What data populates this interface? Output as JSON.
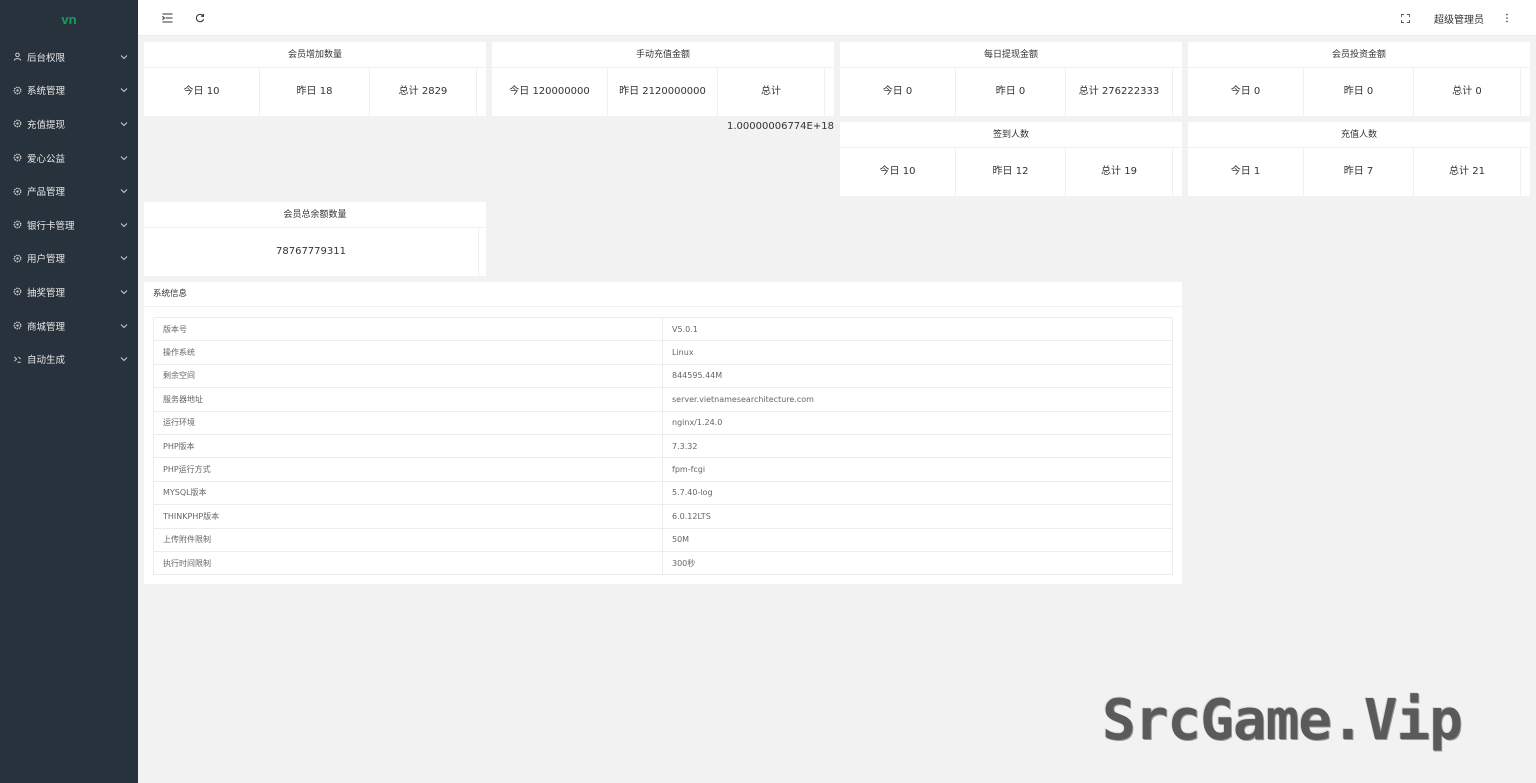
{
  "sidebar": {
    "logo": "vn",
    "items": [
      {
        "label": "后台权限",
        "icon": "user-icon"
      },
      {
        "label": "系统管理",
        "icon": "gear-icon"
      },
      {
        "label": "充值提现",
        "icon": "gear-icon"
      },
      {
        "label": "爱心公益",
        "icon": "gear-icon"
      },
      {
        "label": "产品管理",
        "icon": "gear-icon"
      },
      {
        "label": "银行卡管理",
        "icon": "gear-icon"
      },
      {
        "label": "用户管理",
        "icon": "gear-icon"
      },
      {
        "label": "抽奖管理",
        "icon": "gear-icon"
      },
      {
        "label": "商城管理",
        "icon": "gear-icon"
      },
      {
        "label": "自动生成",
        "icon": "code-icon"
      }
    ]
  },
  "header": {
    "admin_name": "超级管理员"
  },
  "cards": {
    "member_increase": {
      "title": "会员增加数量",
      "today": "今日 10",
      "yesterday": "昨日 18",
      "total": "总计 2829"
    },
    "manual_recharge": {
      "title": "手动充值金额",
      "today": "今日 120000000",
      "yesterday": "昨日 2120000000",
      "total": "总计",
      "total_value": "1.00000006774E+18"
    },
    "daily_withdraw": {
      "title": "每日提现金额",
      "today": "今日 0",
      "yesterday": "昨日 0",
      "total": "总计 276222333"
    },
    "member_invest": {
      "title": "会员投资金额",
      "today": "今日 0",
      "yesterday": "昨日 0",
      "total": "总计 0"
    },
    "checkin_count": {
      "title": "签到人数",
      "today": "今日 10",
      "yesterday": "昨日 12",
      "total": "总计 19"
    },
    "recharge_count": {
      "title": "充值人数",
      "today": "今日 1",
      "yesterday": "昨日 7",
      "total": "总计 21"
    },
    "member_balance": {
      "title": "会员总余额数量",
      "value": "78767779311"
    }
  },
  "system_info": {
    "title": "系统信息",
    "rows": [
      {
        "key": "版本号",
        "value": "V5.0.1"
      },
      {
        "key": "操作系统",
        "value": "Linux"
      },
      {
        "key": "剩余空间",
        "value": "844595.44M"
      },
      {
        "key": "服务器地址",
        "value": "server.vietnamesearchitecture.com"
      },
      {
        "key": "运行环境",
        "value": "nginx/1.24.0"
      },
      {
        "key": "PHP版本",
        "value": "7.3.32"
      },
      {
        "key": "PHP运行方式",
        "value": "fpm-fcgi"
      },
      {
        "key": "MYSQL版本",
        "value": "5.7.40-log"
      },
      {
        "key": "THINKPHP版本",
        "value": "6.0.12LTS"
      },
      {
        "key": "上传附件限制",
        "value": "50M"
      },
      {
        "key": "执行时间限制",
        "value": "300秒"
      }
    ]
  },
  "watermark": "SrcGame.Vip"
}
